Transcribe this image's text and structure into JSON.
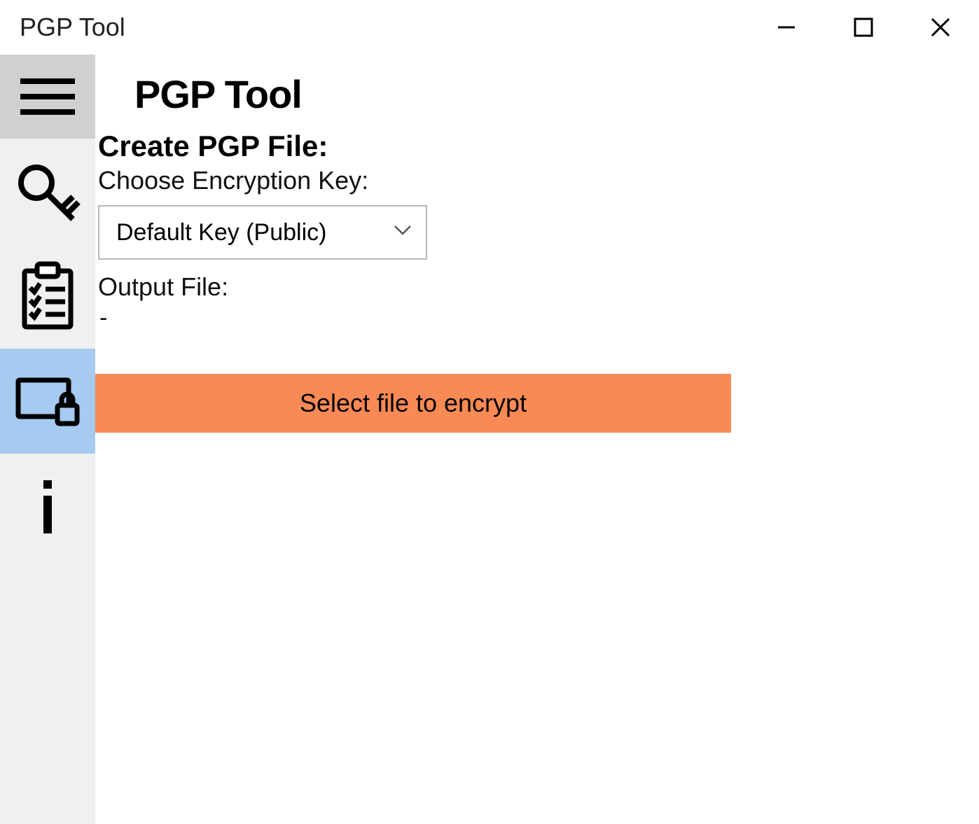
{
  "titlebar": {
    "title": "PGP Tool"
  },
  "sidebar": {
    "items": [
      {
        "id": "menu",
        "icon": "hamburger"
      },
      {
        "id": "keys",
        "icon": "key"
      },
      {
        "id": "tasks",
        "icon": "clipboard"
      },
      {
        "id": "encrypt",
        "icon": "encrypt-screen",
        "selected": true
      },
      {
        "id": "about",
        "icon": "info"
      }
    ]
  },
  "main": {
    "app_heading": "PGP Tool",
    "section_heading": "Create PGP File:",
    "encryption_key_label": "Choose Encryption Key:",
    "encryption_key_selected": "Default Key (Public)",
    "output_file_label": "Output File:",
    "output_file_value": "-",
    "select_file_button": "Select file to encrypt"
  },
  "colors": {
    "accent": "#fa8a55",
    "sidebar_bg": "#f0f0f0",
    "sidebar_selected": "#a6caf0",
    "hamburger_bg": "#d0d0d0"
  }
}
